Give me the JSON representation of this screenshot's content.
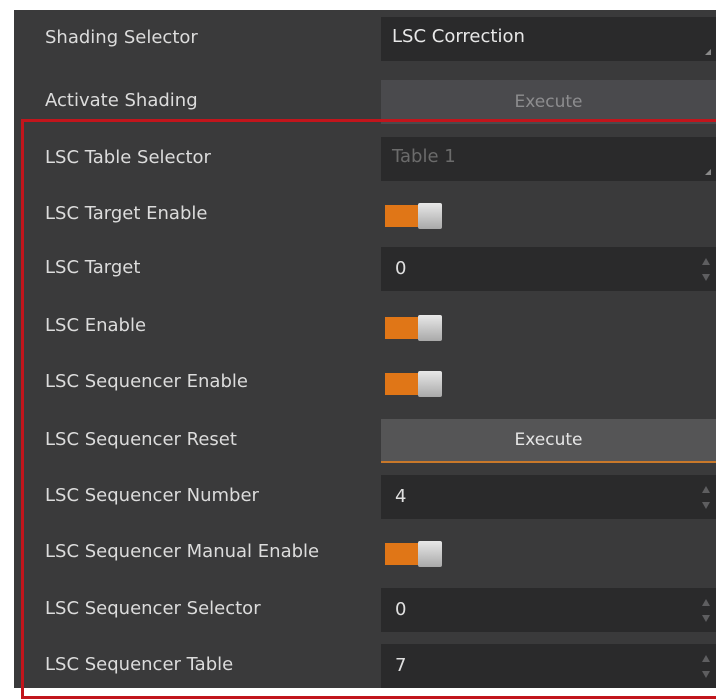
{
  "rows": [
    {
      "label": "Shading Selector",
      "type": "dropdown",
      "value": "LSC Correction"
    },
    {
      "label": "Activate Shading",
      "type": "button",
      "value": "Execute"
    },
    {
      "label": "LSC Table Selector",
      "type": "dropdown",
      "value": "Table 1"
    },
    {
      "label": "LSC Target Enable",
      "type": "toggle",
      "enabled": true
    },
    {
      "label": "LSC Target",
      "type": "numeric",
      "value": "0"
    },
    {
      "label": "LSC Enable",
      "type": "toggle",
      "enabled": true
    },
    {
      "label": "LSC Sequencer Enable",
      "type": "toggle",
      "enabled": true
    },
    {
      "label": "LSC Sequencer Reset",
      "type": "button",
      "value": "Execute"
    },
    {
      "label": "LSC Sequencer Number",
      "type": "numeric",
      "value": "4"
    },
    {
      "label": "LSC Sequencer Manual Enable",
      "type": "toggle",
      "enabled": true
    },
    {
      "label": "LSC Sequencer Selector",
      "type": "numeric",
      "value": "0"
    },
    {
      "label": "LSC Sequencer Table",
      "type": "numeric",
      "value": "7"
    }
  ],
  "colors": {
    "panel_bg": "#3a3a3b",
    "toggle_on": "#e07617",
    "highlight_border": "#c2151c",
    "button_underline": "#c8782a"
  },
  "icons": {
    "dropdown": "dropdown-corner-icon",
    "spinner_up": "spin-up-icon",
    "spinner_down": "spin-down-icon"
  }
}
